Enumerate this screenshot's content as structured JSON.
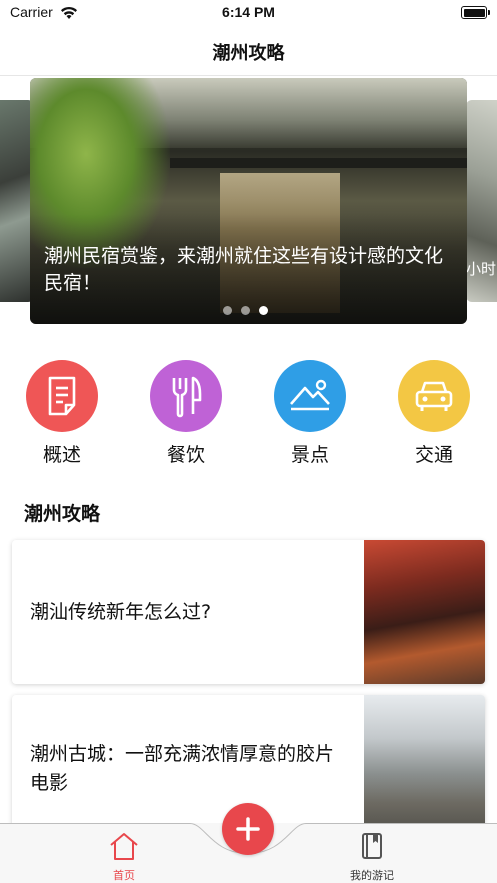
{
  "status_bar": {
    "carrier": "Carrier",
    "time": "6:14 PM"
  },
  "nav": {
    "title": "潮州攻略"
  },
  "carousel": {
    "caption": "潮州民宿赏鉴，来潮州就住这些有设计感的文化民宿！",
    "right_peek_text": "小时",
    "dot_count": 3,
    "active_dot": 3
  },
  "categories": [
    {
      "label": "概述",
      "icon": "document-icon",
      "color": "#ef5656"
    },
    {
      "label": "餐饮",
      "icon": "fork-knife-icon",
      "color": "#bf62d6"
    },
    {
      "label": "景点",
      "icon": "mountain-icon",
      "color": "#2f9ee6"
    },
    {
      "label": "交通",
      "icon": "car-icon",
      "color": "#f3c744"
    }
  ],
  "section": {
    "title": "潮州攻略"
  },
  "articles": [
    {
      "title": "潮汕传统新年怎么过?"
    },
    {
      "title": "潮州古城：一部充满浓情厚意的胶片电影"
    }
  ],
  "tab_bar": {
    "home_label": "首页",
    "notes_label": "我的游记",
    "active_color": "#e8474c"
  }
}
